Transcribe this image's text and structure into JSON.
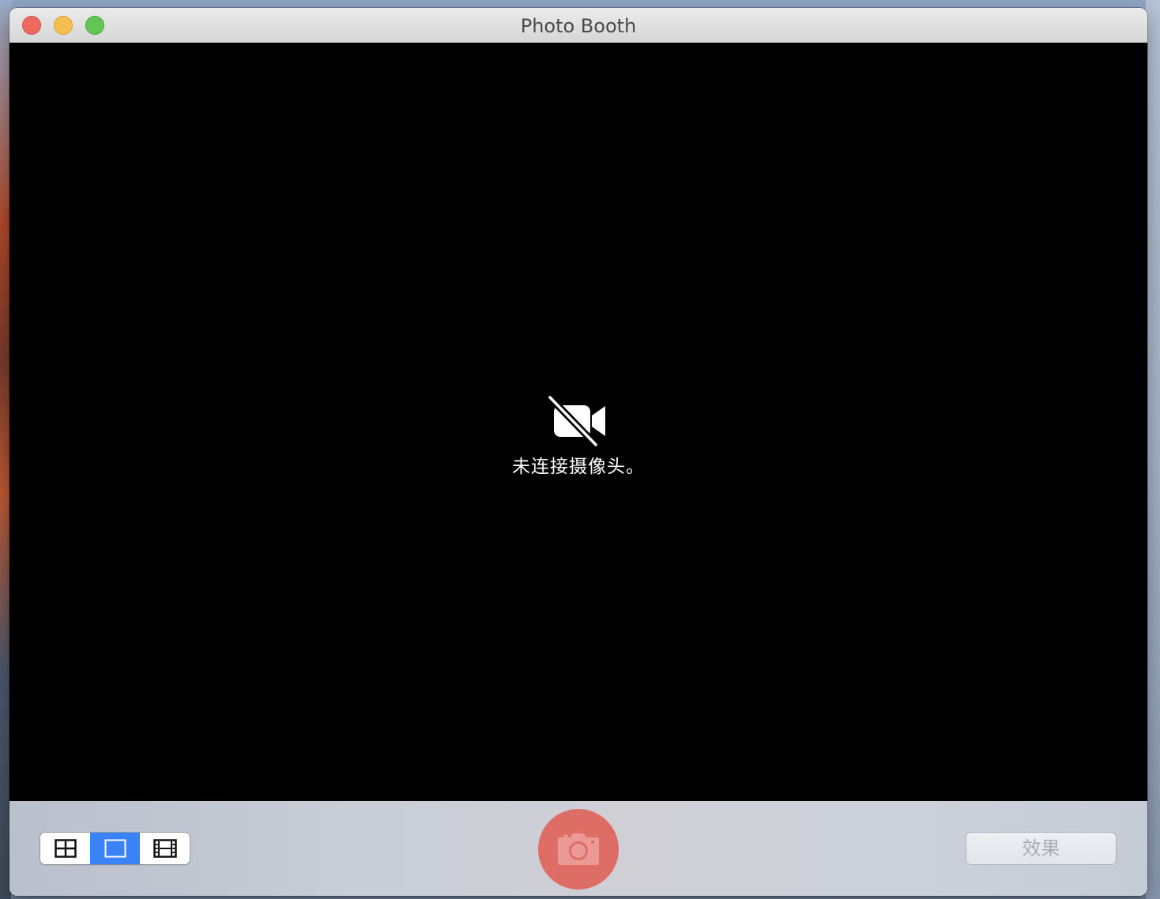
{
  "window": {
    "title": "Photo Booth"
  },
  "titlebar": {
    "buttons": [
      "close",
      "minimize",
      "maximize"
    ]
  },
  "camera_view": {
    "status_icon": "video-camera-slash-icon",
    "status_text": "未连接摄像头。"
  },
  "toolbar": {
    "view_modes": [
      {
        "icon": "four-up-grid-icon",
        "selected": false
      },
      {
        "icon": "single-photo-icon",
        "selected": true
      },
      {
        "icon": "film-strip-icon",
        "selected": false
      }
    ],
    "shutter_icon": "camera-icon",
    "effects_label": "效果"
  },
  "colors": {
    "close": "#ee6a5f",
    "minimize": "#f5be4f",
    "maximize": "#62c655",
    "selected_segment": "#3a82f7",
    "shutter": "#de6d66"
  }
}
